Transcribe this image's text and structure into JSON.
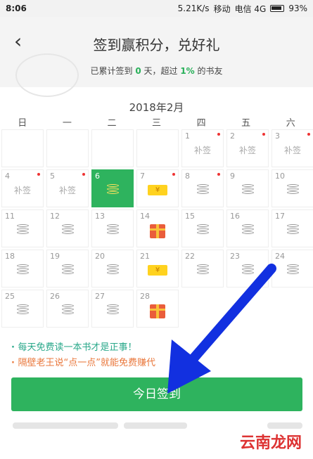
{
  "status": {
    "time": "8:06",
    "net_speed": "5.21K/s",
    "carrier1": "移动",
    "carrier2": "电信 4G",
    "battery": "93%"
  },
  "header": {
    "title": "签到赢积分，兑好礼",
    "subtitle_prefix": "已累计签到 ",
    "days": "0",
    "subtitle_mid": " 天，超过 ",
    "percent": "1%",
    "subtitle_suffix": " 的书友"
  },
  "calendar": {
    "month": "2018年2月",
    "weekdays": [
      "日",
      "一",
      "二",
      "三",
      "四",
      "五",
      "六"
    ],
    "makeup_label": "补签",
    "ticket_label": "¥",
    "days": [
      {
        "n": "1",
        "type": "makeup"
      },
      {
        "n": "2",
        "type": "makeup"
      },
      {
        "n": "3",
        "type": "makeup"
      },
      {
        "n": "4",
        "type": "makeup"
      },
      {
        "n": "5",
        "type": "makeup"
      },
      {
        "n": "6",
        "type": "today"
      },
      {
        "n": "7",
        "type": "ticket"
      },
      {
        "n": "8",
        "type": "coin"
      },
      {
        "n": "9",
        "type": "coin"
      },
      {
        "n": "10",
        "type": "coin"
      },
      {
        "n": "11",
        "type": "coin"
      },
      {
        "n": "12",
        "type": "coin"
      },
      {
        "n": "13",
        "type": "coin"
      },
      {
        "n": "14",
        "type": "gift"
      },
      {
        "n": "15",
        "type": "coin"
      },
      {
        "n": "16",
        "type": "coin"
      },
      {
        "n": "17",
        "type": "coin"
      },
      {
        "n": "18",
        "type": "coin"
      },
      {
        "n": "19",
        "type": "coin"
      },
      {
        "n": "20",
        "type": "coin"
      },
      {
        "n": "21",
        "type": "ticket"
      },
      {
        "n": "22",
        "type": "coin"
      },
      {
        "n": "23",
        "type": "coin"
      },
      {
        "n": "24",
        "type": "coin"
      },
      {
        "n": "25",
        "type": "coin"
      },
      {
        "n": "26",
        "type": "coin"
      },
      {
        "n": "27",
        "type": "coin"
      },
      {
        "n": "28",
        "type": "gift"
      }
    ]
  },
  "tips": [
    "每天免费读一本书才是正事！",
    "隔壁老王说“点一点”就能免费赚代"
  ],
  "checkin_button": "今日签到",
  "watermark": "云南龙网",
  "colors": {
    "accent": "#2eb35e",
    "arrow": "#1230e0"
  }
}
